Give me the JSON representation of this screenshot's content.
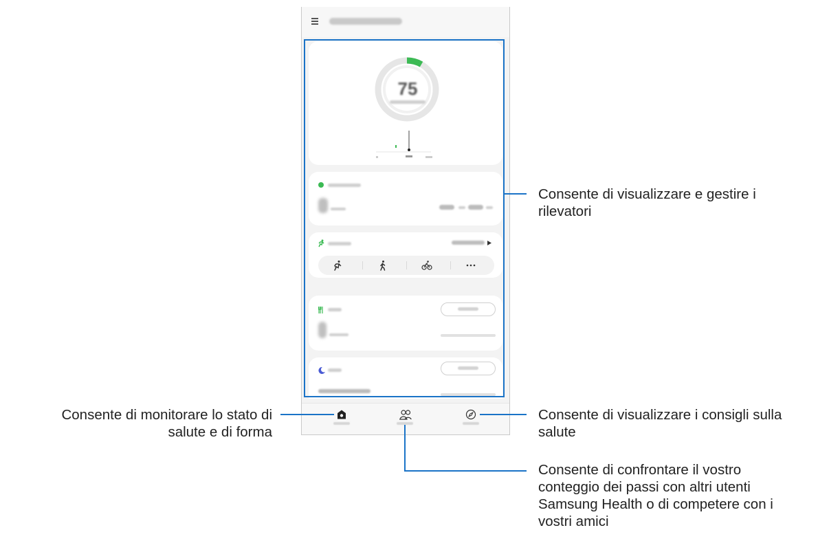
{
  "callouts": {
    "trackers": "Consente di visualizzare e gestire i rilevatori",
    "home": "Consente di monitorare lo stato di salute e di forma",
    "discover": "Consente di visualizzare i consigli sulla salute",
    "together": "Consente di confrontare il vostro conteggio dei passi con altri utenti Samsung Health o di competere con i vostri amici"
  },
  "callout_lines": {
    "trackers": [
      "Consente di visualizzare e gestire i",
      "rilevatori"
    ],
    "home": [
      "Consente di monitorare lo stato di",
      "salute e di forma"
    ],
    "discover": [
      "Consente di visualizzare i consigli sulla",
      "salute"
    ],
    "together": [
      "Consente di confrontare il vostro",
      "conteggio dei passi con altri utenti",
      "Samsung Health o di competere con i",
      "vostri amici"
    ]
  },
  "steps_card": {
    "value": "75",
    "progress_fraction": 0.06
  },
  "colors": {
    "accent": "#1a73c7",
    "green": "#3cba54",
    "sleep": "#4a5bd4"
  },
  "icons": [
    "menu-icon",
    "run-icon",
    "walk-icon",
    "bike-icon",
    "more-icon",
    "utensils-icon",
    "moon-icon",
    "home-icon",
    "people-icon",
    "compass-icon"
  ]
}
